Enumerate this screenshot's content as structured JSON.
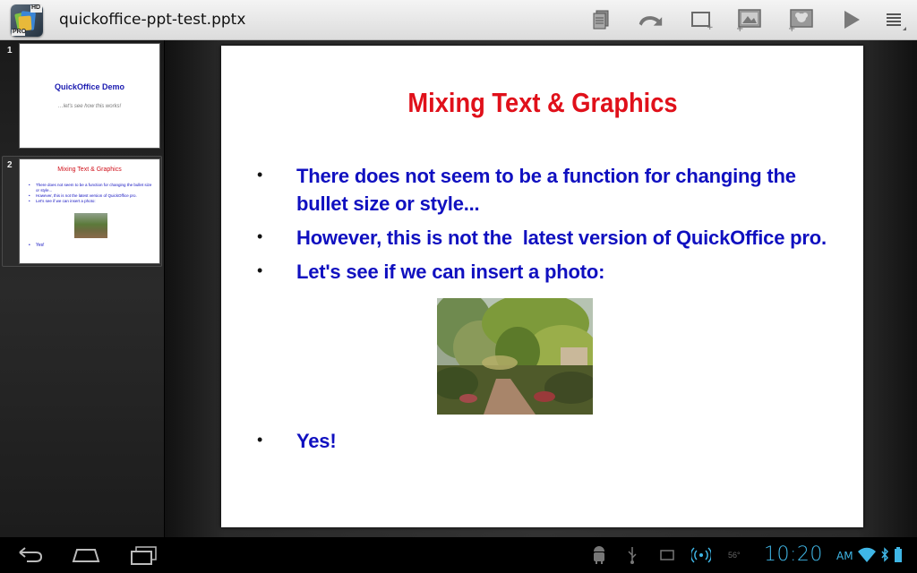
{
  "app": {
    "icon_name": "quickoffice-pro-hd-icon",
    "icon_badge_top": "HD",
    "icon_badge_bottom": "PRO",
    "document_title": "quickoffice-ppt-test.pptx"
  },
  "toolbar": {
    "buttons": [
      {
        "name": "file-actions-icon"
      },
      {
        "name": "undo-icon"
      },
      {
        "name": "new-slide-icon"
      },
      {
        "name": "insert-image-icon"
      },
      {
        "name": "insert-clipart-icon"
      },
      {
        "name": "play-slideshow-icon"
      },
      {
        "name": "overflow-menu-icon"
      }
    ]
  },
  "thumbnails": [
    {
      "number": "1",
      "title": "QuickOffice Demo",
      "subtitle": "…let's see how this works!"
    },
    {
      "number": "2",
      "title": "Mixing Text & Graphics",
      "bullets": [
        "There does not seem to be a function for changing the bullet size or style...",
        "However, this is not the  latest version of QuickOffice pro.",
        "Let's see if we can insert a photo:"
      ],
      "last_bullet": "Yes!"
    }
  ],
  "slide": {
    "title": "Mixing Text & Graphics",
    "bullet_symbol": "•",
    "bullets": [
      "There does not seem to be a function for changing the bullet size or style...",
      "However, this is not the  latest version of QuickOffice pro.",
      "Let's see if we can insert a photo:"
    ],
    "final_bullet": "Yes!",
    "title_color": "#e0101a",
    "text_color": "#1010c0"
  },
  "statusbar": {
    "time": "10:20",
    "ampm": "AM",
    "temperature": "56°",
    "clock_color": "#3fb6e6"
  }
}
